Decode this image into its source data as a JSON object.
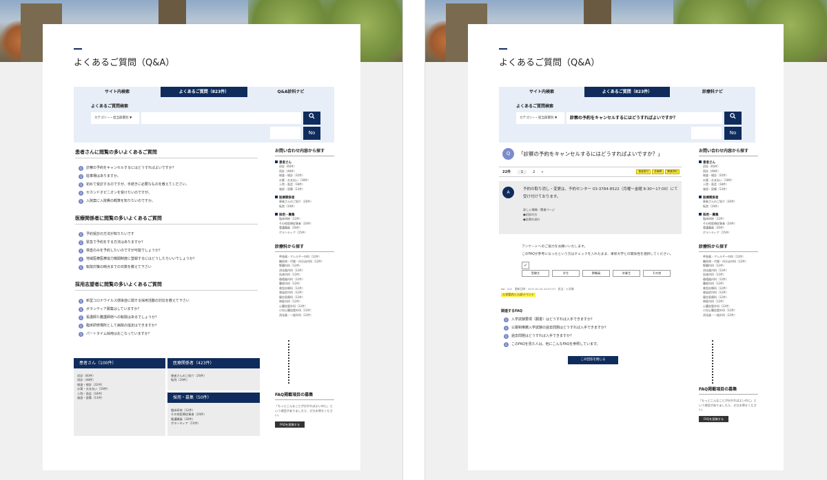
{
  "left": {
    "page_title": "よくあるご質問（Q&A）",
    "tabs": [
      "サイト内検索",
      "よくあるご質問（823件）",
      "Q&A診科ナビ"
    ],
    "search": {
      "label": "よくあるご質問検索",
      "category": "カテゴリー・担当部署別",
      "no_label": "No"
    },
    "sections": [
      {
        "title": "患者さんに閲覧の多いよくあるご質問",
        "items": [
          "診察の予約をキャンセルするにはどうすればよいですか？",
          "駐車場はありますか。",
          "初めて受診するのですが、手続きに必要なものを教えてください。",
          "セカンドオピニオンを受けたいのですが。",
          "入院案に入院費の概算を知りたいのですか。"
        ]
      },
      {
        "title": "医療関係者に閲覧の多いよくあるご質問",
        "items": [
          "予約受診の方法が知りたいです",
          "緊急で予約をする方法はありますか？",
          "検査のみを予約したいのですが可能でしょうか？",
          "地域医療医療協力機関制度に登録するにはどうしたらいいでしょうか？",
          "転院対策の時点までの日数を教えて下さい"
        ]
      },
      {
        "title": "採用志望者に閲覧の多いよくあるご質問",
        "items": [
          "新型コロナウイルス感染症に関する採用活動の対応を教えて下さい",
          "ボランティア募集はしていますか？",
          "看護師た難護師術への転院はあるでしょうか？",
          "臨床研修場所として病院の指定はできますか？",
          "パートタイム採用はおこなっていますか？"
        ]
      }
    ],
    "cat_boxes": [
      {
        "title": "患者さん（100件）",
        "items": [
          "初診（60件）",
          "再診（48件）",
          "検査・検診（32件）",
          "お薬・お支払い（18件）",
          "入院・面会（18件）",
          "施設・設備（13件）"
        ]
      },
      {
        "title": "医療関係者（423件）",
        "items": [
          "患者さんのご紹介（26件）",
          "転院（19件）"
        ]
      },
      {
        "title": "採用・募集（50件）",
        "items": [
          "臨床研修（12件）",
          "その他医療従事者（20件）",
          "看護職員（30件）",
          "ボランティア（15件）"
        ]
      }
    ]
  },
  "right": {
    "page_title": "よくあるご質問（Q&A）",
    "tabs": [
      "サイト内検索",
      "よくあるご質問（823件）",
      "診療科ナビ"
    ],
    "search": {
      "label": "よくあるご質問検索",
      "category": "カテゴリー・担当部署別",
      "query": "診察の予約をキャンセルするにはどうすればよいですか？",
      "no_label": "No"
    },
    "question_mark": "Q",
    "question": "「診察の予約をキャンセルするにはどうすればよいですか？」",
    "pager": {
      "count": "22件",
      "pages": [
        "1",
        "2",
        "»"
      ],
      "tags": [
        "患者受付",
        "診療費",
        "関連資料"
      ]
    },
    "answer_mark": "A",
    "answer": "予約の取り消し・変更は、予約センター 03-3784-8522（月曜～金曜 8:30～17:00）にて受け付けております。",
    "related_links": [
      "詳しい情報・関連ページ",
      "●初診の方",
      "●診察の流れ"
    ],
    "survey": [
      "アンケートへのご協力をお願いいたします。",
      "このFAQが参考になったという方はチェックを入れたまま、事修大学との関係性を選択してください。"
    ],
    "checkbox_mark": "✓",
    "choices": [
      "受験生",
      "学生",
      "教職員",
      "卒業生",
      "その他"
    ],
    "meta": "No：221　更新日時：2017.01.24 10:37:37　担当：入学課",
    "highlight": "入学案内＞入試イベント",
    "related_title": "関連するFAQ",
    "related_faq": [
      "入学試験要項（願書）はどうすれば入手できますか？",
      "公募制推薦入学試験の過去問題はどうすれば入手できますか？",
      "過去問題はどうすれば入手できますか？",
      "このFAQを見た人は、他にこんなFAQを参照しています。"
    ],
    "close_button": "この回答を閉じる"
  },
  "sidebar": {
    "title": "お問い合わせ内容から探す",
    "groups": [
      {
        "title": "患者さん",
        "items": [
          "初診（60件）",
          "再診（48件）",
          "検査・検診（32件）",
          "お薬・お支払い（18件）",
          "入院・面会（18件）",
          "施設・設備（13件）"
        ]
      },
      {
        "title": "医療関係者",
        "items": [
          "患者さんのご紹介（26件）",
          "転院（19件）"
        ]
      },
      {
        "title": "採用・募集",
        "items": [
          "臨床研修（12件）",
          "その他医療従事者（20件）",
          "看護職員（30件）",
          "ボランティア（15件）"
        ]
      }
    ],
    "dept_title": "診療科から探す",
    "depts": [
      "呼吸器・アレルギー内科（12件）",
      "糖尿病・代謝・内分泌内科（12件）",
      "腎臓内科（12件）",
      "消化器内科（12件）",
      "血液内科（12件）",
      "循環器内科（12件）",
      "腫瘍内科（12件）",
      "救急診療科（12件）",
      "感染症内科（12件）",
      "健診医療科（12件）",
      "神経内科（12件）",
      "心臓血管外科（12件）",
      "小児心臓血管外科（12件）",
      "消化器・一般外科（12件）"
    ],
    "feedback_title": "FAQ掲載項目の募集",
    "feedback_desc": "「もっとこんなことが分かればよいのに」という項目がありましたら、ぜひお寄せください。",
    "feedback_button": "FAQを投稿する"
  },
  "colors": {
    "navy": "#0f2c5c",
    "qmark": "#6f7fc0",
    "highlight": "#ffef33"
  }
}
